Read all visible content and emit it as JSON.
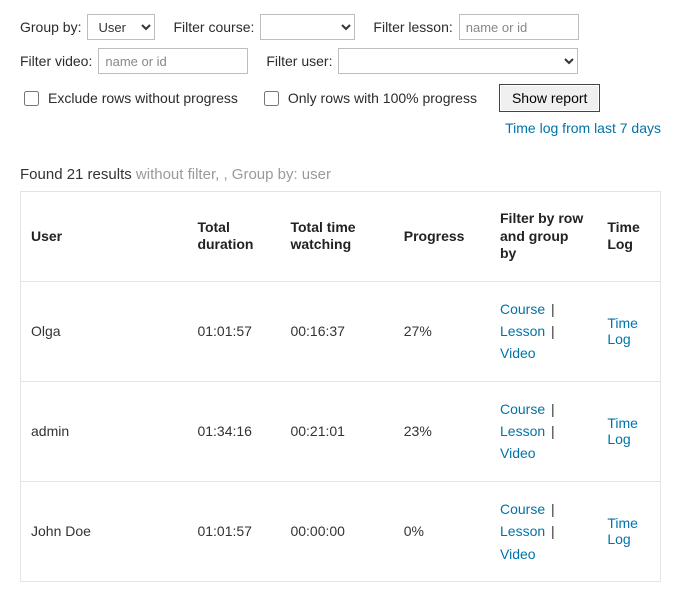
{
  "filters": {
    "group_by_label": "Group by:",
    "group_by_value": "User",
    "filter_course_label": "Filter course:",
    "filter_course_value": "",
    "filter_lesson_label": "Filter lesson:",
    "filter_lesson_placeholder": "name or id",
    "filter_video_label": "Filter video:",
    "filter_video_placeholder": "name or id",
    "filter_user_label": "Filter user:",
    "filter_user_value": "",
    "exclude_label": "Exclude rows without progress",
    "only100_label": "Only rows with 100% progress",
    "show_report_label": "Show report"
  },
  "link_time_log_7days": "Time log from last 7 days",
  "summary": {
    "found_prefix": "Found 21 results",
    "detail": " without filter, , Group by: user"
  },
  "columns": {
    "user": "User",
    "total_duration": "Total duration",
    "total_time_watching": "Total time watching",
    "progress": "Progress",
    "filter_by": "Filter by row and group by",
    "time_log": "Time Log"
  },
  "filter_links": {
    "course": "Course",
    "lesson": "Lesson",
    "video": "Video"
  },
  "time_log_link": "Time Log",
  "rows": [
    {
      "user": "Olga",
      "total_duration": "01:01:57",
      "total_time_watching": "00:16:37",
      "progress": "27%"
    },
    {
      "user": "admin",
      "total_duration": "01:34:16",
      "total_time_watching": "00:21:01",
      "progress": "23%"
    },
    {
      "user": "John Doe",
      "total_duration": "01:01:57",
      "total_time_watching": "00:00:00",
      "progress": "0%"
    }
  ]
}
